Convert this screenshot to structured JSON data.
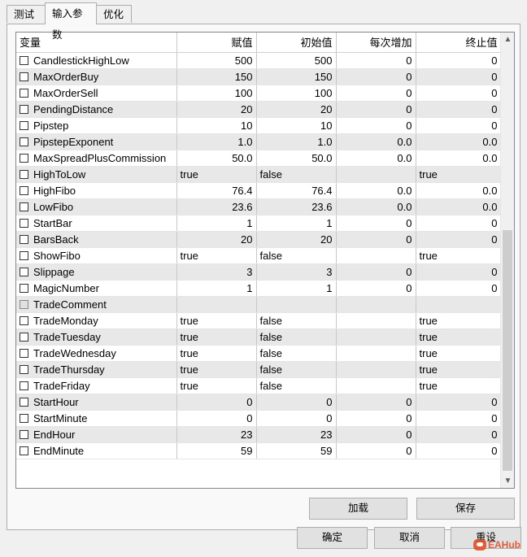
{
  "tabs": [
    "测试",
    "输入参数",
    "优化"
  ],
  "active_tab": 1,
  "columns": [
    "变量",
    "赋值",
    "初始值",
    "每次增加",
    "终止值"
  ],
  "rows": [
    {
      "name": "CandlestickHighLow",
      "value": "500",
      "start": "500",
      "step": "0",
      "stop": "0",
      "numeric": true
    },
    {
      "name": "MaxOrderBuy",
      "value": "150",
      "start": "150",
      "step": "0",
      "stop": "0",
      "numeric": true
    },
    {
      "name": "MaxOrderSell",
      "value": "100",
      "start": "100",
      "step": "0",
      "stop": "0",
      "numeric": true
    },
    {
      "name": "PendingDistance",
      "value": "20",
      "start": "20",
      "step": "0",
      "stop": "0",
      "numeric": true
    },
    {
      "name": "Pipstep",
      "value": "10",
      "start": "10",
      "step": "0",
      "stop": "0",
      "numeric": true
    },
    {
      "name": "PipstepExponent",
      "value": "1.0",
      "start": "1.0",
      "step": "0.0",
      "stop": "0.0",
      "numeric": true
    },
    {
      "name": "MaxSpreadPlusCommission",
      "value": "50.0",
      "start": "50.0",
      "step": "0.0",
      "stop": "0.0",
      "numeric": true
    },
    {
      "name": "HighToLow",
      "value": "true",
      "start": "false",
      "step": "",
      "stop": "true",
      "numeric": false
    },
    {
      "name": "HighFibo",
      "value": "76.4",
      "start": "76.4",
      "step": "0.0",
      "stop": "0.0",
      "numeric": true
    },
    {
      "name": "LowFibo",
      "value": "23.6",
      "start": "23.6",
      "step": "0.0",
      "stop": "0.0",
      "numeric": true
    },
    {
      "name": "StartBar",
      "value": "1",
      "start": "1",
      "step": "0",
      "stop": "0",
      "numeric": true
    },
    {
      "name": "BarsBack",
      "value": "20",
      "start": "20",
      "step": "0",
      "stop": "0",
      "numeric": true
    },
    {
      "name": "ShowFibo",
      "value": "true",
      "start": "false",
      "step": "",
      "stop": "true",
      "numeric": false
    },
    {
      "name": "Slippage",
      "value": "3",
      "start": "3",
      "step": "0",
      "stop": "0",
      "numeric": true
    },
    {
      "name": "MagicNumber",
      "value": "1",
      "start": "1",
      "step": "0",
      "stop": "0",
      "numeric": true
    },
    {
      "name": "TradeComment",
      "value": "",
      "start": "",
      "step": "",
      "stop": "",
      "numeric": false,
      "disabled": true
    },
    {
      "name": "TradeMonday",
      "value": "true",
      "start": "false",
      "step": "",
      "stop": "true",
      "numeric": false
    },
    {
      "name": "TradeTuesday",
      "value": "true",
      "start": "false",
      "step": "",
      "stop": "true",
      "numeric": false
    },
    {
      "name": "TradeWednesday",
      "value": "true",
      "start": "false",
      "step": "",
      "stop": "true",
      "numeric": false
    },
    {
      "name": "TradeThursday",
      "value": "true",
      "start": "false",
      "step": "",
      "stop": "true",
      "numeric": false
    },
    {
      "name": "TradeFriday",
      "value": "true",
      "start": "false",
      "step": "",
      "stop": "true",
      "numeric": false
    },
    {
      "name": "StartHour",
      "value": "0",
      "start": "0",
      "step": "0",
      "stop": "0",
      "numeric": true
    },
    {
      "name": "StartMinute",
      "value": "0",
      "start": "0",
      "step": "0",
      "stop": "0",
      "numeric": true
    },
    {
      "name": "EndHour",
      "value": "23",
      "start": "23",
      "step": "0",
      "stop": "0",
      "numeric": true
    },
    {
      "name": "EndMinute",
      "value": "59",
      "start": "59",
      "step": "0",
      "stop": "0",
      "numeric": true
    }
  ],
  "buttons": {
    "load": "加载",
    "save": "保存",
    "ok": "确定",
    "cancel": "取消",
    "reset": "重设"
  },
  "watermark": "EAHub",
  "colors": {
    "alt_row": "#e8e8e8",
    "grid_border": "#828790",
    "button_bg": "#e1e1e1"
  }
}
